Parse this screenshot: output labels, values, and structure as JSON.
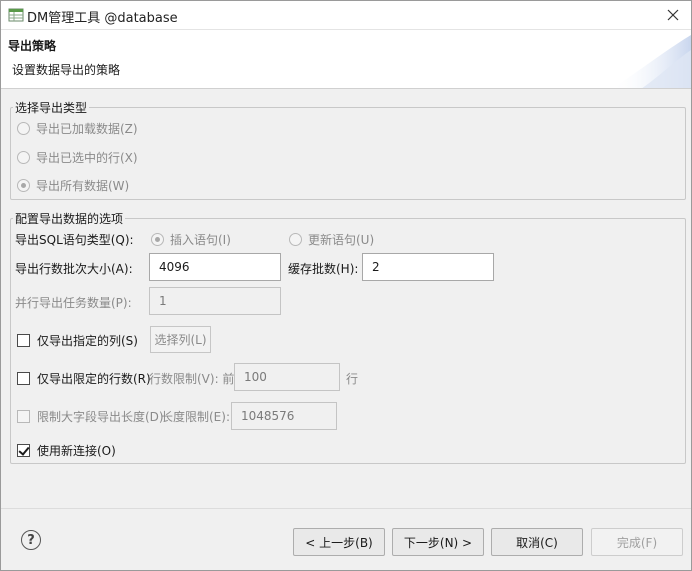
{
  "window": {
    "title": "DM管理工具 @database"
  },
  "banner": {
    "title": "导出策略",
    "description": "设置数据导出的策略"
  },
  "export_type_group": {
    "legend": "选择导出类型",
    "options": [
      {
        "label": "导出已加载数据(Z)",
        "checked": false,
        "enabled": false
      },
      {
        "label": "导出已选中的行(X)",
        "checked": false,
        "enabled": false
      },
      {
        "label": "导出所有数据(W)",
        "checked": true,
        "enabled": false
      }
    ]
  },
  "options_group": {
    "legend": "配置导出数据的选项",
    "sql_type": {
      "label": "导出SQL语句类型(Q):",
      "options": [
        {
          "label": "插入语句(I)",
          "checked": true
        },
        {
          "label": "更新语句(U)",
          "checked": false
        }
      ]
    },
    "batch_size": {
      "label": "导出行数批次大小(A):",
      "value": "4096"
    },
    "cache_batches": {
      "label": "缓存批数(H):",
      "value": "2"
    },
    "parallel_tasks": {
      "label": "并行导出任务数量(P):",
      "value": "1"
    },
    "specified_columns": {
      "label": "仅导出指定的列(S)",
      "checked": false,
      "button": "选择列(L)"
    },
    "limited_rows": {
      "label": "仅导出限定的行数(R)",
      "checked": false,
      "limit_label": "行数限制(V): 前",
      "value": "100",
      "unit": "行"
    },
    "limit_lob": {
      "label": "限制大字段导出长度(D)",
      "checked": false,
      "length_label": "长度限制(E):",
      "value": "1048576"
    },
    "new_connection": {
      "label": "使用新连接(O)",
      "checked": true
    }
  },
  "footer": {
    "help_icon": "question-mark-icon",
    "back": "< 上一步(B)",
    "next": "下一步(N) >",
    "cancel": "取消(C)",
    "finish": "完成(F)"
  }
}
